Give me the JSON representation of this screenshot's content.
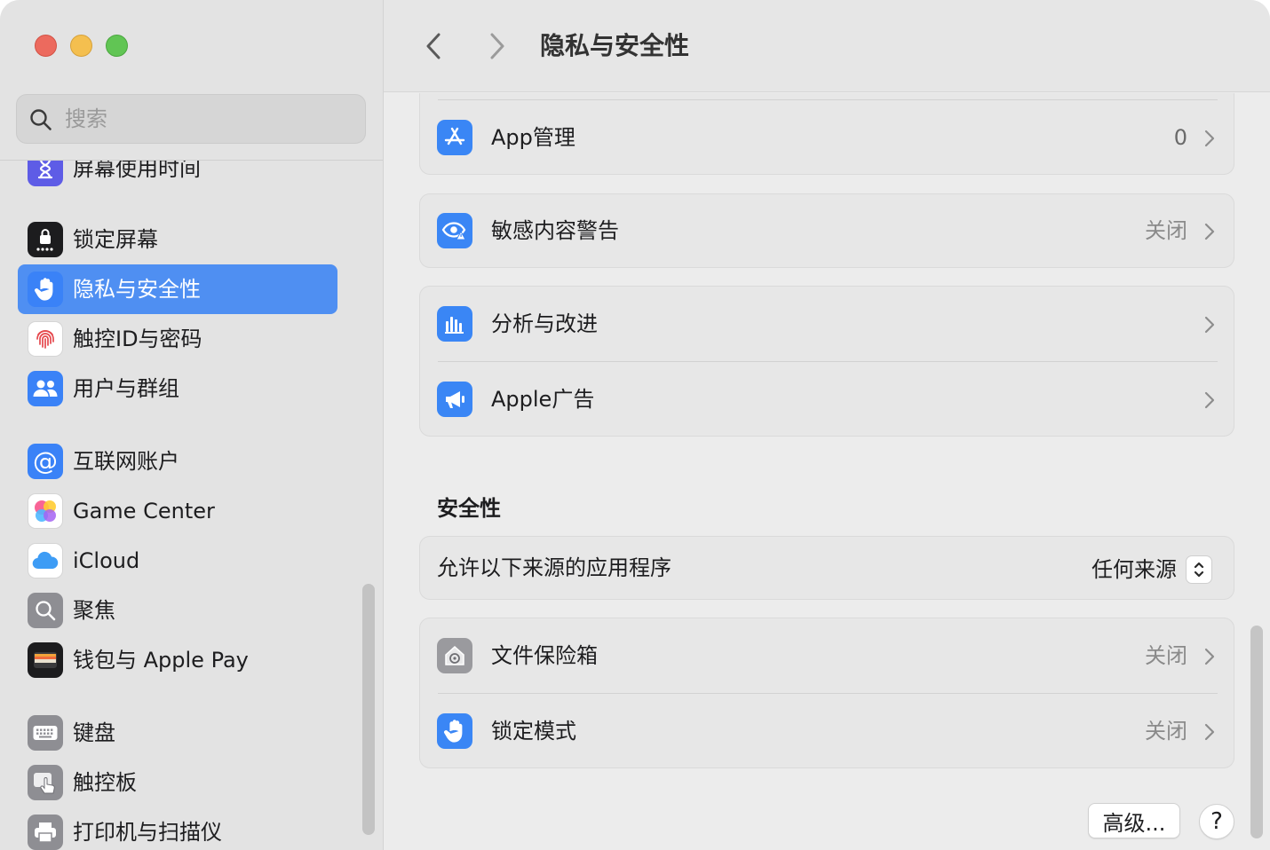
{
  "window": {
    "traffic_lights": [
      "close",
      "minimize",
      "zoom"
    ]
  },
  "search": {
    "placeholder": "搜索",
    "value": ""
  },
  "sidebar": {
    "items": [
      {
        "label": "屏幕使用时间",
        "icon": "hourglass-icon",
        "color": "#5e5ce6"
      },
      {
        "label": "锁定屏幕",
        "icon": "lock-screen-icon",
        "color": "#1c1c1e"
      },
      {
        "label": "隐私与安全性",
        "icon": "hand-icon",
        "color": "#3a82f7",
        "selected": true
      },
      {
        "label": "触控ID与密码",
        "icon": "fingerprint-icon",
        "color": "#ffffff"
      },
      {
        "label": "用户与群组",
        "icon": "users-icon",
        "color": "#3a82f7"
      },
      {
        "label": "互联网账户",
        "icon": "at-icon",
        "color": "#3a82f7"
      },
      {
        "label": "Game Center",
        "icon": "game-center-icon",
        "color": "#ffffff"
      },
      {
        "label": "iCloud",
        "icon": "cloud-icon",
        "color": "#ffffff"
      },
      {
        "label": "聚焦",
        "icon": "spotlight-icon",
        "color": "#8e8e93"
      },
      {
        "label": "钱包与 Apple Pay",
        "icon": "wallet-icon",
        "color": "#1c1c1e"
      },
      {
        "label": "键盘",
        "icon": "keyboard-icon",
        "color": "#8e8e93"
      },
      {
        "label": "触控板",
        "icon": "trackpad-icon",
        "color": "#8e8e93"
      },
      {
        "label": "打印机与扫描仪",
        "icon": "printer-icon",
        "color": "#8e8e93"
      }
    ]
  },
  "header": {
    "title": "隐私与安全性",
    "back_icon": "chevron-left-icon",
    "forward_icon": "chevron-right-icon"
  },
  "main": {
    "privacy_rows": [
      {
        "label": "App管理",
        "value": "0",
        "icon": "app-store-icon"
      },
      {
        "label": "敏感内容警告",
        "value": "关闭",
        "icon": "eye-warning-icon"
      },
      {
        "label": "分析与改进",
        "value": "",
        "icon": "analytics-icon"
      },
      {
        "label": "Apple广告",
        "value": "",
        "icon": "megaphone-icon"
      }
    ],
    "security_title": "安全性",
    "allow_apps": {
      "label": "允许以下来源的应用程序",
      "value": "任何来源"
    },
    "security_rows": [
      {
        "label": "文件保险箱",
        "value": "关闭",
        "icon": "filevault-icon"
      },
      {
        "label": "锁定模式",
        "value": "关闭",
        "icon": "hand-icon"
      }
    ],
    "advanced_button": "高级...",
    "help_button": "?"
  },
  "colors": {
    "accent": "#4f8ff2",
    "sidebar_bg": "#e3e3e3",
    "content_bg": "#ececec"
  }
}
